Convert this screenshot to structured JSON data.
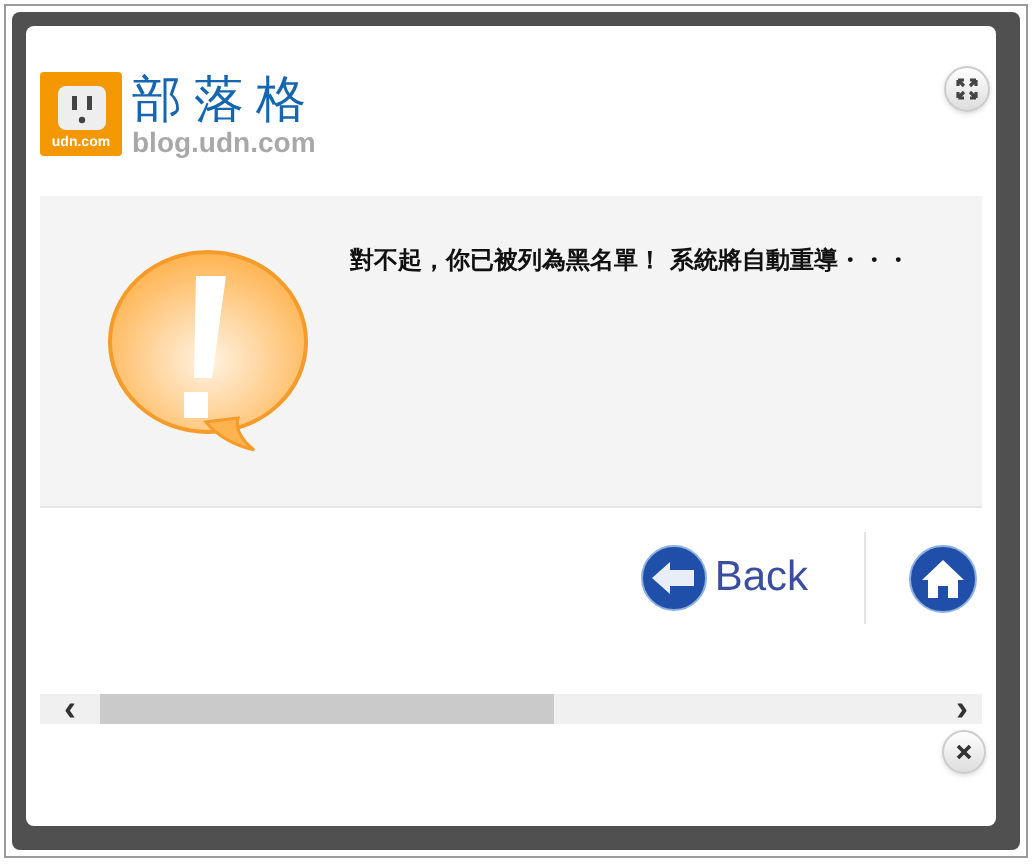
{
  "logo": {
    "badge": "udn.com",
    "title": "部落格",
    "subtitle": "blog.udn.com"
  },
  "message": "對不起，你已被列為黑名單！ 系統將自動重導・・・",
  "back_button": {
    "label": "Back"
  },
  "scroll_arrows": {
    "left": "‹",
    "right": "›"
  }
}
